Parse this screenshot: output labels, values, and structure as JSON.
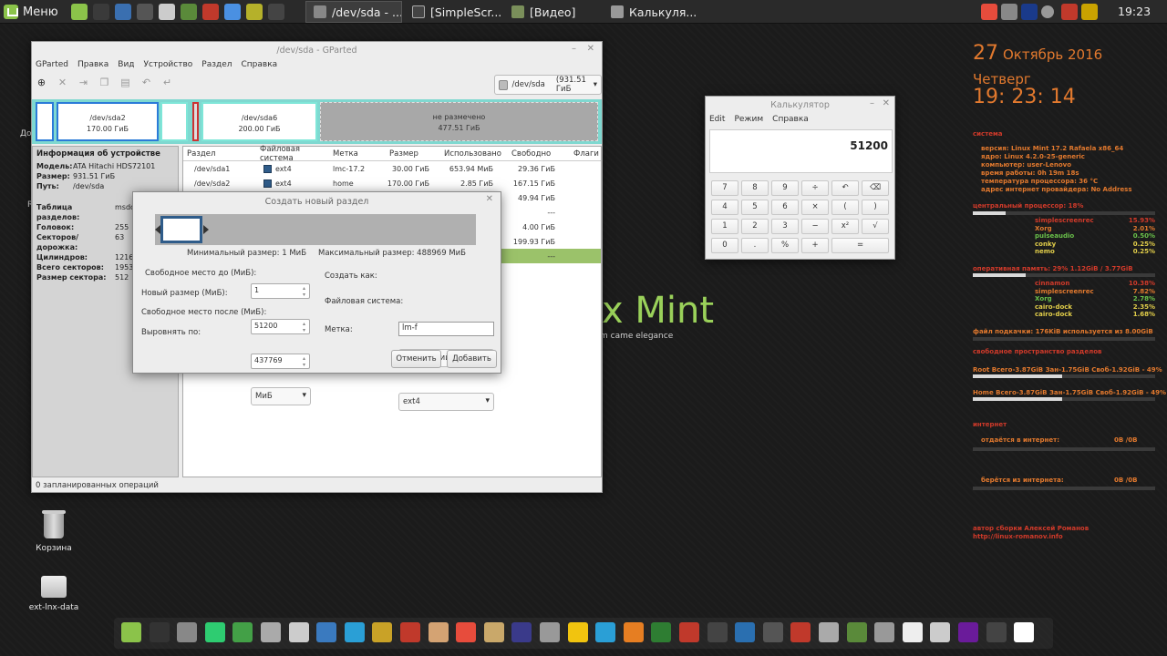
{
  "taskbar": {
    "menu_label": "Меню",
    "tasks": [
      "/dev/sda - ...",
      "[SimpleScr...",
      "[Видео]",
      "Калькуля..."
    ],
    "clock": "19:23",
    "launcher_colors": [
      "#8bc34a",
      "#3a3a3a",
      "#3a6fb0",
      "#555555",
      "#cccccc",
      "#5a8a3a",
      "#c0392b",
      "#4a90e2",
      "#b5b12a",
      "#444444"
    ],
    "tray_colors": [
      "#e74c3c",
      "#888888",
      "#1a3a8a",
      "#999999",
      "#c0392b",
      "#c9a200"
    ]
  },
  "desktop": {
    "icons": [
      {
        "label": "Корзина",
        "icon": "trash-icon"
      },
      {
        "label": "ext-lnx-data",
        "icon": "drive-icon"
      }
    ],
    "side_labels": [
      "До",
      "R"
    ]
  },
  "gparted": {
    "title": "/dev/sda - GParted",
    "menu": [
      "GParted",
      "Правка",
      "Вид",
      "Устройство",
      "Раздел",
      "Справка"
    ],
    "device": {
      "name": "/dev/sda",
      "size": "(931.51 ГиБ"
    },
    "map": [
      {
        "name": "/dev/sda2",
        "size": "170.00 ГиБ"
      },
      {
        "name": "/dev/sda6",
        "size": "200.00 ГиБ"
      },
      {
        "name": "не размечено",
        "size": "477.51 ГиБ"
      }
    ],
    "device_info": {
      "heading": "Информация об устройстве",
      "rows1": [
        {
          "k": "Модель:",
          "v": "ATA Hitachi HDS72101"
        },
        {
          "k": "Размер:",
          "v": "931.51 ГиБ"
        },
        {
          "k": "Путь:",
          "v": "/dev/sda"
        }
      ],
      "rows2": [
        {
          "k": "Таблица разделов:",
          "v": "msdo"
        },
        {
          "k": "Головок:",
          "v": "255"
        },
        {
          "k": "Секторов/дорожка:",
          "v": "63"
        },
        {
          "k": "Цилиндров:",
          "v": "1216"
        },
        {
          "k": "Всего секторов:",
          "v": "1953"
        },
        {
          "k": "Размер сектора:",
          "v": "512"
        }
      ]
    },
    "table": {
      "headers": [
        "Раздел",
        "Файловая система",
        "Метка",
        "Размер",
        "Использовано",
        "Свободно",
        "Флаги"
      ],
      "rows": [
        {
          "part": "/dev/sda1",
          "fs": "ext4",
          "label": "lmc-17.2",
          "size": "30.00 ГиБ",
          "used": "653.94 МиБ",
          "free": "29.36 ГиБ",
          "flags": ""
        },
        {
          "part": "/dev/sda2",
          "fs": "ext4",
          "label": "home",
          "size": "170.00 ГиБ",
          "used": "2.85 ГиБ",
          "free": "167.15 ГиБ",
          "flags": ""
        },
        {
          "part": "",
          "fs": "",
          "label": "",
          "size": "",
          "used": "",
          "free": "49.94 ГиБ",
          "flags": ""
        },
        {
          "part": "",
          "fs": "",
          "label": "",
          "size": "",
          "used": "",
          "free": "---",
          "flags": ""
        },
        {
          "part": "",
          "fs": "",
          "label": "",
          "size": "",
          "used": "",
          "free": "4.00 ГиБ",
          "flags": ""
        },
        {
          "part": "",
          "fs": "",
          "label": "",
          "size": "",
          "used": "",
          "free": "199.93 ГиБ",
          "flags": ""
        },
        {
          "part": "",
          "fs": "",
          "label": "",
          "size": "",
          "used": "",
          "free": "---",
          "flags": ""
        }
      ]
    },
    "status": "0 запланированных операций"
  },
  "dialog": {
    "title": "Создать новый раздел",
    "min_size": "Минимальный размер: 1 МиБ",
    "max_size": "Максимальный размер: 488969 МиБ",
    "free_before_label": "Свободное место до (МиБ):",
    "free_before": "1",
    "new_size_label": "Новый размер (МиБ):",
    "new_size": "51200",
    "free_after_label": "Свободное место после (МиБ):",
    "free_after": "437769",
    "align_label": "Выровнять по:",
    "align": "МиБ",
    "create_as_label": "Создать как:",
    "create_as": "логический раздел",
    "fs_label": "Файловая система:",
    "fs": "ext4",
    "label_label": "Метка:",
    "label_value": "lm-f",
    "cancel": "Отменить",
    "add": "Добавить"
  },
  "calculator": {
    "title": "Калькулятор",
    "menu": [
      "Edit",
      "Режим",
      "Справка"
    ],
    "display": "51200",
    "keys": [
      [
        "7",
        "8",
        "9",
        "÷",
        "↶",
        "⌫"
      ],
      [
        "4",
        "5",
        "6",
        "×",
        "(",
        ")"
      ],
      [
        "1",
        "2",
        "3",
        "−",
        "x²",
        "√"
      ],
      [
        "0",
        ".",
        "%",
        "+",
        "="
      ]
    ]
  },
  "mint_logo": {
    "text": "x Mint",
    "tagline": "m came elegance"
  },
  "conky": {
    "day": "27",
    "month_year": "Октябрь 2016",
    "weekday": "Четверг",
    "time": "19: 23: 14",
    "system_heading": "система",
    "system_lines": [
      "версия: Linux Mint 17.2 Rafaela x86_64",
      "ядро: Linux 4.2.0-25-generic",
      "компьютер: user-Lenovo",
      "время работы: 0h 19m 18s",
      "температура процессора: 36 °C",
      "адрес интернет провайдера: No Address"
    ],
    "cpu_heading": "центральный процессор: 18%",
    "cpu_percent": 18,
    "cpu_procs": [
      {
        "name": "simplescreenrec",
        "val": "15.93%",
        "color": "red"
      },
      {
        "name": "Xorg",
        "val": "2.01%",
        "color": "orange"
      },
      {
        "name": "pulseaudio",
        "val": "0.50%",
        "color": "green"
      },
      {
        "name": "conky",
        "val": "0.25%",
        "color": "yellow"
      },
      {
        "name": "nemo",
        "val": "0.25%",
        "color": "yellow"
      }
    ],
    "mem_heading": "оперативная память: 29% 1.12GiB / 3.77GiB",
    "mem_percent": 29,
    "mem_procs": [
      {
        "name": "cinnamon",
        "val": "10.38%",
        "color": "red"
      },
      {
        "name": "simplescreenrec",
        "val": "7.82%",
        "color": "orange"
      },
      {
        "name": "Xorg",
        "val": "2.78%",
        "color": "green"
      },
      {
        "name": "cairo-dock",
        "val": "2.35%",
        "color": "yellow"
      },
      {
        "name": "cairo-dock",
        "val": "1.68%",
        "color": "yellow"
      }
    ],
    "swap_line": "файл подкачки: 176KiB используется из 8.00GiB",
    "disk_heading": "свободное пространство разделов",
    "root_line": "Root Всего-3.87GiB Зан-1.75GiB Своб-1.92GiB - 49%",
    "root_percent": 49,
    "home_line": "Home Всего-3.87GiB Зан-1.75GiB Своб-1.92GiB - 49%",
    "home_percent": 49,
    "net_heading": "интернет",
    "upload_label": "отдаётся в интернет:",
    "upload_val": "0B  /0B",
    "download_label": "берётся из интернета:",
    "download_val": "0B  /0B",
    "author": "автор сборки Алексей Романов",
    "url": "http://linux-romanov.info"
  },
  "dock": {
    "colors": [
      "#8bc34a",
      "#333333",
      "#888888",
      "#2ecc71",
      "#43a047",
      "#aaaaaa",
      "#cccccc",
      "#3a7abf",
      "#2a9fd6",
      "#c9a227",
      "#c0392b",
      "#d4a373",
      "#e74c3c",
      "#c9a86a",
      "#3a3a8a",
      "#999999",
      "#f1c40f",
      "#2a9fd6",
      "#e67e22",
      "#2e7d32",
      "#c0392b",
      "#444444",
      "#2a6fb0",
      "#555555",
      "#c0392b",
      "#aaaaaa",
      "#5a8a3a",
      "#999999",
      "#eeeeee",
      "#cccccc",
      "#6a1b9a",
      "#444444",
      "#ffffff"
    ]
  }
}
